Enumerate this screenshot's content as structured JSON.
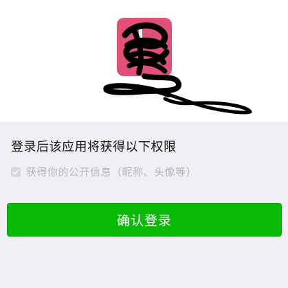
{
  "permissions": {
    "title": "登录后该应用将获得以下权限",
    "items": [
      {
        "label": "获得你的公开信息（昵称、头像等）",
        "checked": true
      }
    ]
  },
  "confirm_button": {
    "label": "确认登录"
  },
  "colors": {
    "logo_pink": "#e0517a",
    "button_green": "#09bb07",
    "panel_bg": "#efeff4"
  },
  "icons": {
    "app_logo": "scribbled-app-logo",
    "checkbox": "check-icon"
  }
}
